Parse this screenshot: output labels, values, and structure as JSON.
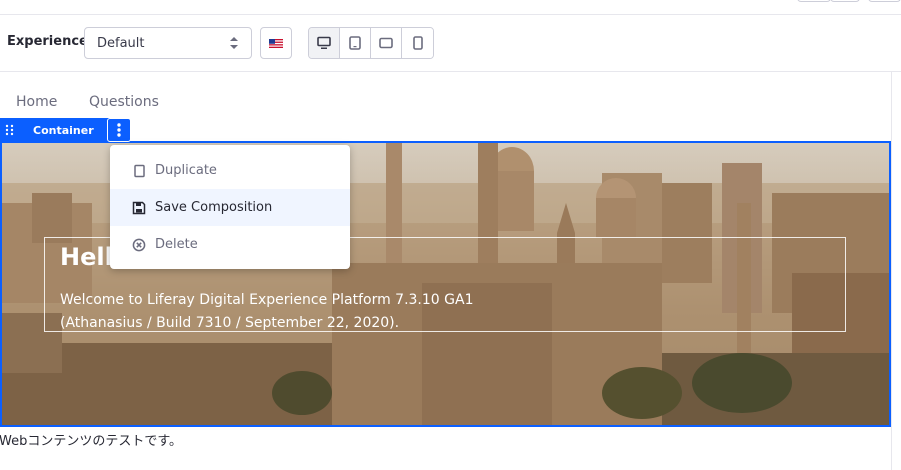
{
  "toolbar": {
    "experience_label": "Experience",
    "experience_select": "Default",
    "language_flag": "flag-us-icon",
    "devices": [
      "desktop-icon",
      "tablet-icon",
      "landscape-phone-icon",
      "portrait-phone-icon"
    ],
    "active_device": "desktop"
  },
  "nav": {
    "items": [
      {
        "label": "Home"
      },
      {
        "label": "Questions"
      }
    ]
  },
  "container": {
    "label": "Container"
  },
  "menu": {
    "items": [
      {
        "label": "Duplicate",
        "icon": "copy-icon"
      },
      {
        "label": "Save Composition",
        "icon": "save-icon"
      },
      {
        "label": "Delete",
        "icon": "times-circle-icon"
      }
    ]
  },
  "hero": {
    "title": "Hello",
    "text_line1": "Welcome to Liferay Digital Experience Platform 7.3.10 GA1",
    "text_line2": "(Athanasius / Build 7310 / September 22, 2020)."
  },
  "web_content": "Webコンテンツのテストです。",
  "colors": {
    "accent": "#0b5fff",
    "menu_hover": "#f0f5ff",
    "border": "#cdced9"
  }
}
